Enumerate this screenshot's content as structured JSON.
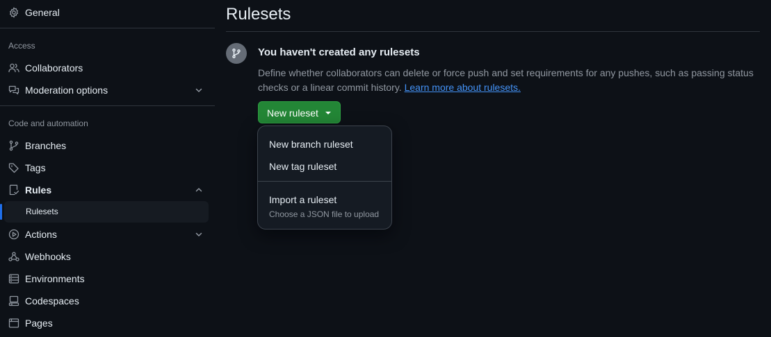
{
  "sidebar": {
    "top_item": {
      "label": "General",
      "icon": "gear-icon"
    },
    "access_heading": "Access",
    "access_items": [
      {
        "label": "Collaborators",
        "icon": "people-icon"
      },
      {
        "label": "Moderation options",
        "icon": "comment-discussion-icon",
        "expandable": true
      }
    ],
    "code_heading": "Code and automation",
    "code_items": [
      {
        "label": "Branches",
        "icon": "git-branch-icon"
      },
      {
        "label": "Tags",
        "icon": "tag-icon"
      },
      {
        "label": "Rules",
        "icon": "repo-rules-icon",
        "expanded": true
      },
      {
        "label": "Actions",
        "icon": "play-icon",
        "expandable": true
      },
      {
        "label": "Webhooks",
        "icon": "webhook-icon"
      },
      {
        "label": "Environments",
        "icon": "server-icon"
      },
      {
        "label": "Codespaces",
        "icon": "codespaces-icon"
      },
      {
        "label": "Pages",
        "icon": "browser-icon"
      }
    ],
    "rules_sub_item": "Rulesets",
    "active_color": "#1f6feb"
  },
  "main": {
    "title": "Rulesets",
    "blankslate": {
      "icon": "git-branch-icon",
      "title": "You haven't created any rulesets",
      "description": "Define whether collaborators can delete or force push and set requirements for any pushes, such as passing status checks or a linear commit history.",
      "link": "Learn more about rulesets."
    },
    "new_button": {
      "label": "New ruleset",
      "color": "#238636"
    },
    "menu": {
      "items": [
        {
          "label": "New branch ruleset"
        },
        {
          "label": "New tag ruleset"
        },
        {
          "label": "Import a ruleset",
          "description": "Choose a JSON file to upload"
        }
      ]
    }
  }
}
